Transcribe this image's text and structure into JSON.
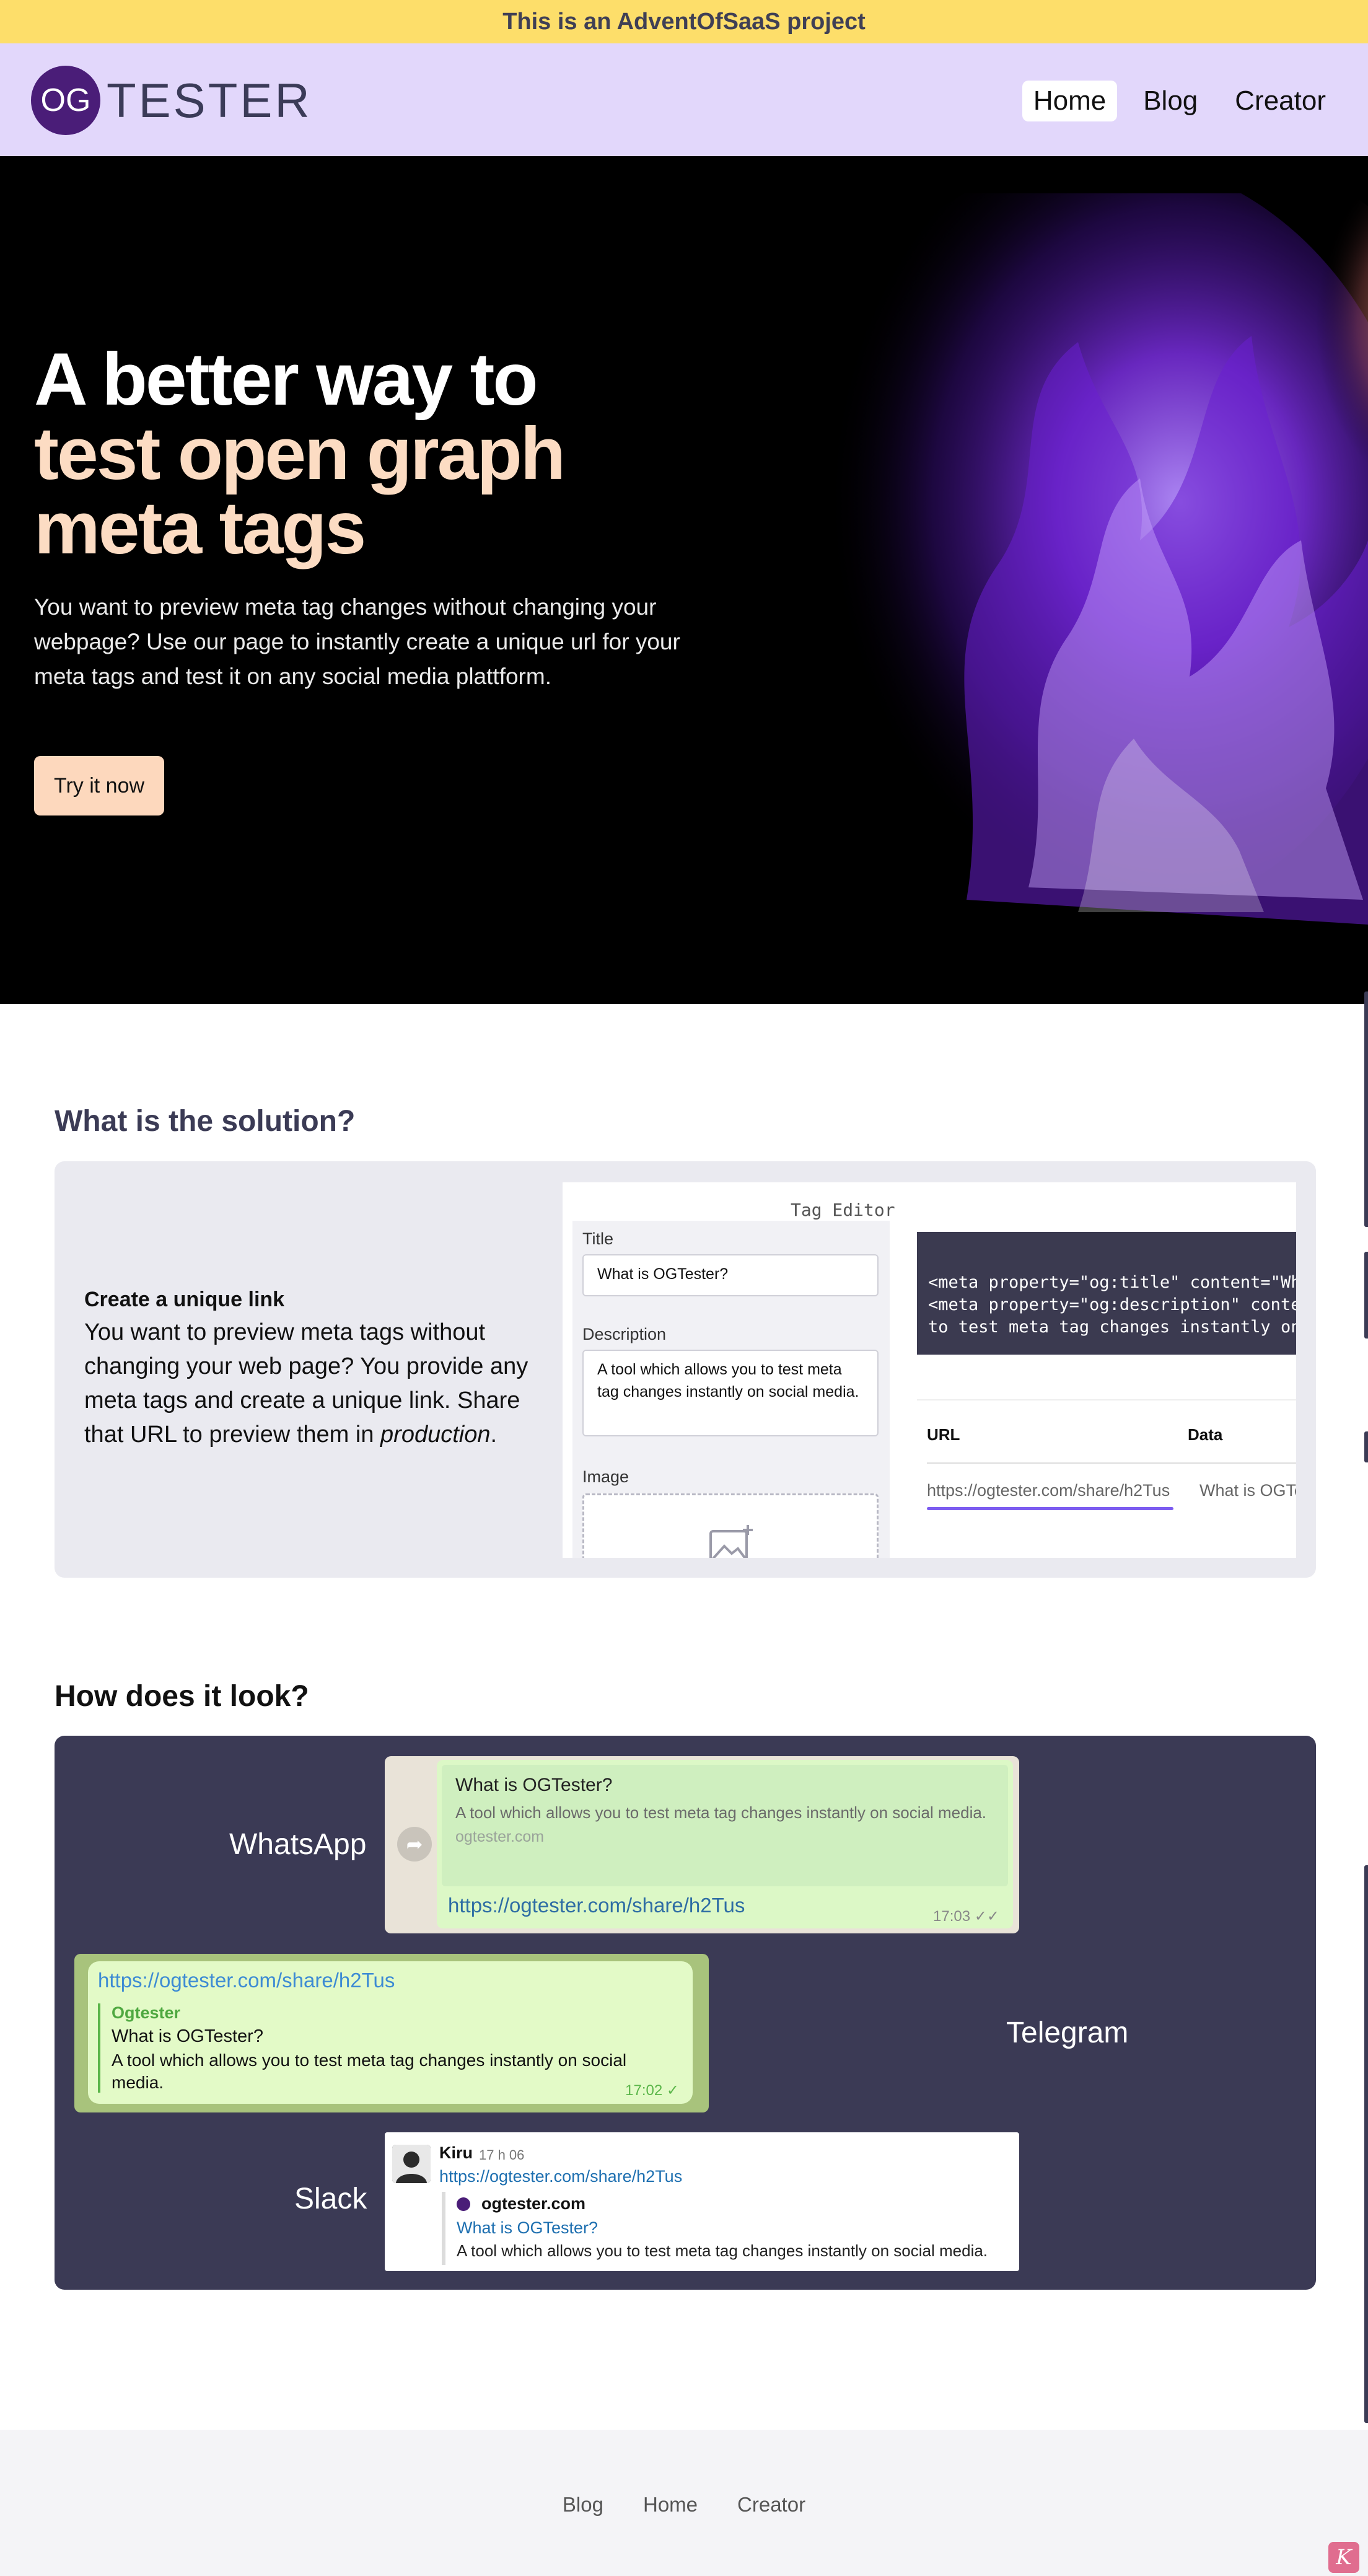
{
  "banner": {
    "text": "This is an AdventOfSaaS project"
  },
  "header": {
    "logo_mark": "OG",
    "logo_text": "TESTER",
    "nav": [
      {
        "label": "Home",
        "active": true
      },
      {
        "label": "Blog",
        "active": false
      },
      {
        "label": "Creator",
        "active": false
      }
    ]
  },
  "hero": {
    "title_line1": "A better way to",
    "title_line2": "test open graph",
    "title_line3": "meta tags",
    "description": "You want to preview meta tag changes without changing your webpage? Use our page to instantly create a unique url for your meta tags and test it on any social media plattform.",
    "cta": "Try it now"
  },
  "solution": {
    "heading": "What is the solution?",
    "title": "Create a unique link",
    "description_before": "You want to preview meta tags without changing your web page? You provide any meta tags and create a unique link. Share that URL to preview them in ",
    "description_em": "production",
    "description_after": ".",
    "editor": {
      "title": "Tag Editor",
      "title_label": "Title",
      "title_value": "What is OGTester?",
      "description_label": "Description",
      "description_value": "A tool which allows you to test meta tag changes instantly on social media.",
      "image_label": "Image",
      "code_lines": [
        "<meta property=\"og:title\" content=\"What",
        "<meta property=\"og:description\" content",
        "to test meta tag changes instantly on s"
      ],
      "table_headers": [
        "URL",
        "Data"
      ],
      "table_row": [
        "https://ogtester.com/share/h2Tus",
        "What is OGTe"
      ]
    }
  },
  "preview": {
    "heading": "How does it look?",
    "whatsapp": {
      "label": "WhatsApp",
      "title": "What is OGTester?",
      "description": "A tool which allows you to test meta tag changes instantly on social media.",
      "site": "ogtester.com",
      "link": "https://ogtester.com/share/h2Tus",
      "time": "17:03 ✓✓"
    },
    "telegram": {
      "label": "Telegram",
      "link": "https://ogtester.com/share/h2Tus",
      "site": "Ogtester",
      "title": "What is OGTester?",
      "description": "A tool which allows you to test meta tag changes instantly on social media.",
      "time": "17:02 ✓"
    },
    "slack": {
      "label": "Slack",
      "user": "Kiru",
      "time": "17 h 06",
      "link": "https://ogtester.com/share/h2Tus",
      "site": "ogtester.com",
      "title": "What is OGTester?",
      "description": "A tool which allows you to test meta tag changes instantly on social media."
    }
  },
  "footer": {
    "links": [
      "Blog",
      "Home",
      "Creator"
    ],
    "badge": "K"
  }
}
